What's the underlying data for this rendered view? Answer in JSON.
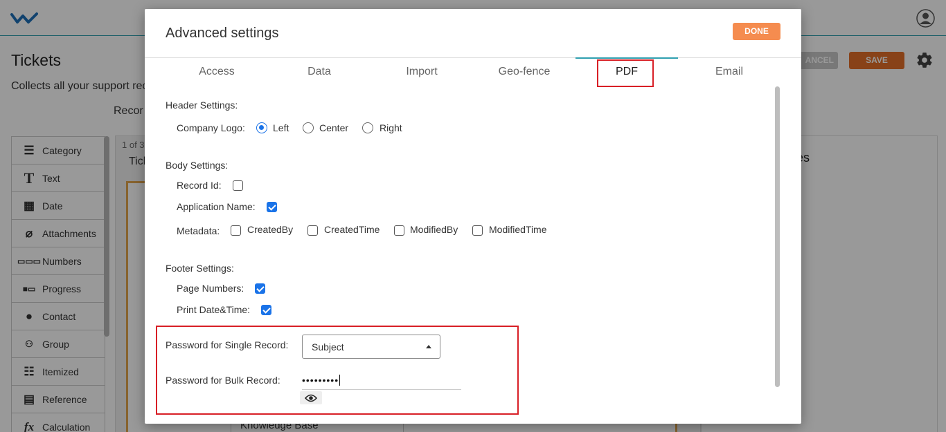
{
  "app": {
    "page_title": "Tickets",
    "page_subtitle": "Collects all your support rec",
    "records_tab": "Recor",
    "cancel_label": "ANCEL",
    "save_label": "SAVE",
    "page_count": "1 of 3",
    "ticket_label": "Tick",
    "application_select": "Knowledge Base",
    "right_panel_title": "es",
    "palette": [
      {
        "label": "Category",
        "icon": "list-icon"
      },
      {
        "label": "Text",
        "icon": "text-icon"
      },
      {
        "label": "Date",
        "icon": "calendar-icon"
      },
      {
        "label": "Attachments",
        "icon": "paperclip-icon"
      },
      {
        "label": "Numbers",
        "icon": "numbers-icon"
      },
      {
        "label": "Progress",
        "icon": "progress-icon"
      },
      {
        "label": "Contact",
        "icon": "contact-icon"
      },
      {
        "label": "Group",
        "icon": "group-icon"
      },
      {
        "label": "Itemized",
        "icon": "itemized-icon"
      },
      {
        "label": "Reference",
        "icon": "document-icon"
      },
      {
        "label": "Calculation",
        "icon": "function-icon"
      }
    ]
  },
  "modal": {
    "title": "Advanced settings",
    "done_label": "DONE",
    "tabs": [
      "Access",
      "Data",
      "Import",
      "Geo-fence",
      "PDF",
      "Email"
    ],
    "active_tab": "PDF",
    "header_settings": {
      "label": "Header Settings:",
      "company_logo_label": "Company Logo:",
      "options": [
        "Left",
        "Center",
        "Right"
      ],
      "selected": "Left"
    },
    "body_settings": {
      "label": "Body Settings:",
      "record_id_label": "Record Id:",
      "record_id_checked": false,
      "application_name_label": "Application Name:",
      "application_name_checked": true,
      "metadata_label": "Metadata:",
      "metadata_options": [
        "CreatedBy",
        "CreatedTime",
        "ModifiedBy",
        "ModifiedTime"
      ]
    },
    "footer_settings": {
      "label": "Footer Settings:",
      "page_numbers_label": "Page Numbers:",
      "page_numbers_checked": true,
      "print_datetime_label": "Print Date&Time:",
      "print_datetime_checked": true
    },
    "password": {
      "single_label": "Password for Single Record:",
      "single_value": "Subject",
      "bulk_label": "Password for Bulk Record:",
      "bulk_value": "•••••••••"
    }
  },
  "colors": {
    "accent_blue": "#1a73e8",
    "teal": "#2f9fb0",
    "done_orange": "#f58c4f",
    "highlight_red": "#d81f26"
  }
}
